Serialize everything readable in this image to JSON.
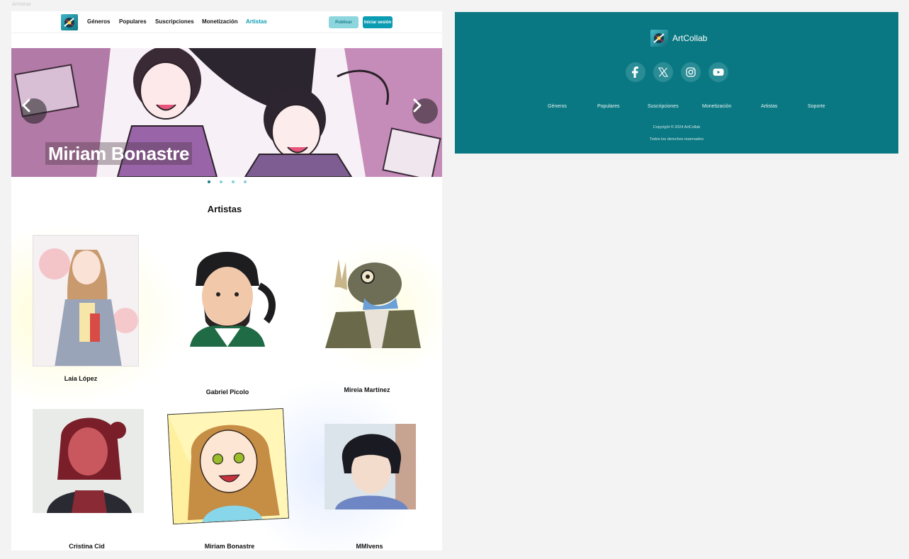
{
  "frame_label": "Artistas",
  "nav": {
    "links": [
      "Géneros",
      "Populares",
      "Suscripciones",
      "Monetización",
      "Artistas"
    ],
    "publish_label": "Publicar",
    "login_label": "Iniciar sesión"
  },
  "hero": {
    "title": "Miriam Bonastre",
    "slide_count": 4,
    "active_slide": 1
  },
  "artists_section": {
    "title": "Artistas",
    "artists": [
      {
        "name": "Laia López"
      },
      {
        "name": "Gabriel Picolo"
      },
      {
        "name": "Mireia Martínez"
      },
      {
        "name": "Cristina Cid"
      },
      {
        "name": "Miriam Bonastre"
      },
      {
        "name": "MMlvens"
      }
    ]
  },
  "footer": {
    "brand": "ArtCollab",
    "social_icons": [
      "facebook-icon",
      "x-icon",
      "instagram-icon",
      "youtube-icon"
    ],
    "links": [
      "Géneros",
      "Populares",
      "Suscripciones",
      "Monetización",
      "Artistas",
      "Soporte"
    ],
    "copyright": "Copyright © 2024 ArtCollab",
    "rights": "Todos los derechos reservados"
  },
  "colors": {
    "accent": "#0a9cb2",
    "footer_bg": "#0a7882",
    "publish_bg": "#8ed6de"
  }
}
